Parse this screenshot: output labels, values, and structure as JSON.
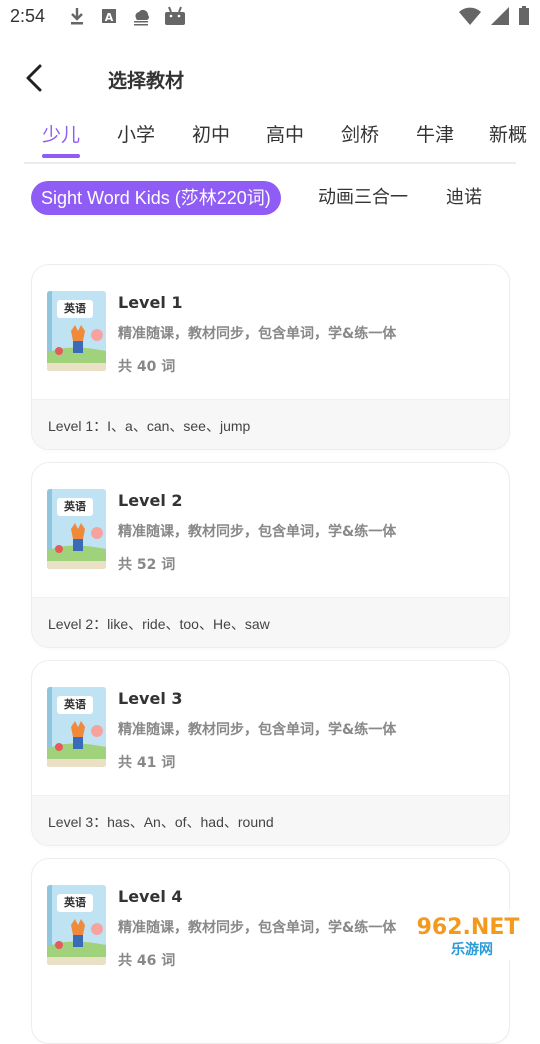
{
  "status_bar": {
    "time": "2:54",
    "left_icons": [
      "download-icon",
      "font-icon",
      "cloud-icon",
      "android-icon"
    ],
    "right_icons": [
      "wifi-icon",
      "signal-icon",
      "battery-icon"
    ]
  },
  "header": {
    "title": "选择教材",
    "back_icon": "back-arrow-icon"
  },
  "tabs": [
    {
      "label": "少儿",
      "active": true
    },
    {
      "label": "小学"
    },
    {
      "label": "初中"
    },
    {
      "label": "高中"
    },
    {
      "label": "剑桥"
    },
    {
      "label": "牛津"
    },
    {
      "label": "新概"
    }
  ],
  "subtabs": [
    {
      "label": "Sight Word Kids (莎林220词)",
      "active": true
    },
    {
      "label": "动画三合一"
    },
    {
      "label": "迪诺"
    }
  ],
  "cards": [
    {
      "cover_label": "英语",
      "title": "Level 1",
      "desc": "精准随课，教材同步，包含单词，学&练一体",
      "count": "共 40 词",
      "words": "Level 1：I、a、can、see、jump"
    },
    {
      "cover_label": "英语",
      "title": "Level 2",
      "desc": "精准随课，教材同步，包含单词，学&练一体",
      "count": "共 52 词",
      "words": "Level 2：like、ride、too、He、saw"
    },
    {
      "cover_label": "英语",
      "title": "Level 3",
      "desc": "精准随课，教材同步，包含单词，学&练一体",
      "count": "共 41 词",
      "words": "Level 3：has、An、of、had、round"
    },
    {
      "cover_label": "英语",
      "title": "Level 4",
      "desc": "精准随课，教材同步，包含单词，学&练一体",
      "count": "共 46 词",
      "words": ""
    }
  ],
  "watermark": {
    "line1": "962.NET",
    "line2": "乐游网"
  },
  "colors": {
    "accent": "#8f5cf6",
    "text": "#333333",
    "muted": "#888888",
    "card_footer": "#f7f7f7"
  }
}
